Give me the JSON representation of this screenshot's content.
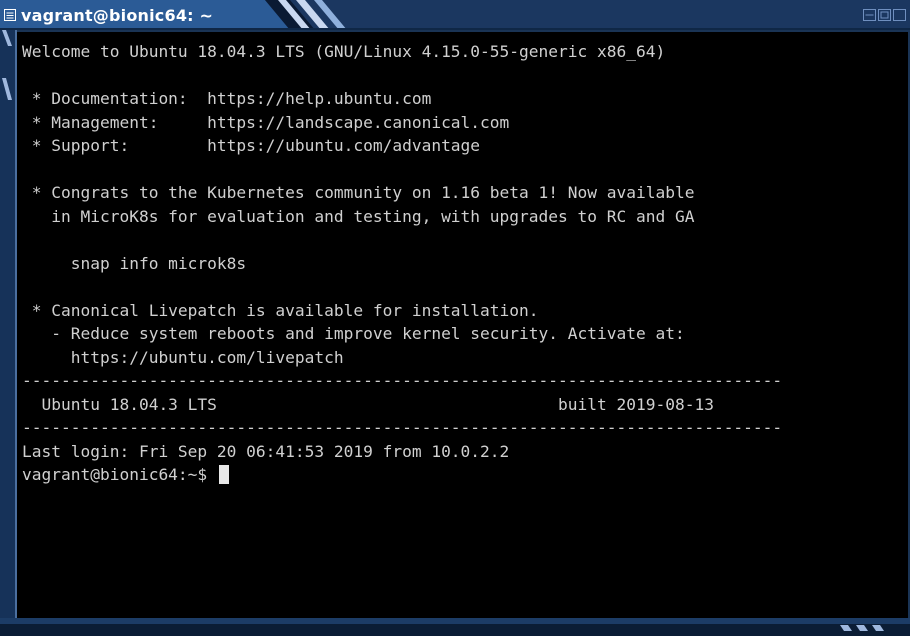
{
  "window": {
    "title": "vagrant@bionic64: ~"
  },
  "terminal": {
    "lines": [
      "Welcome to Ubuntu 18.04.3 LTS (GNU/Linux 4.15.0-55-generic x86_64)",
      "",
      " * Documentation:  https://help.ubuntu.com",
      " * Management:     https://landscape.canonical.com",
      " * Support:        https://ubuntu.com/advantage",
      "",
      " * Congrats to the Kubernetes community on 1.16 beta 1! Now available",
      "   in MicroK8s for evaluation and testing, with upgrades to RC and GA",
      "",
      "     snap info microk8s",
      "",
      " * Canonical Livepatch is available for installation.",
      "   - Reduce system reboots and improve kernel security. Activate at:",
      "     https://ubuntu.com/livepatch",
      "------------------------------------------------------------------------------",
      "  Ubuntu 18.04.3 LTS                                   built 2019-08-13",
      "------------------------------------------------------------------------------",
      "Last login: Fri Sep 20 06:41:53 2019 from 10.0.2.2"
    ],
    "prompt": "vagrant@bionic64:~$ "
  },
  "colors": {
    "titlebar": "#1b3760",
    "terminal_bg": "#000000",
    "terminal_fg": "#d0d0d0"
  }
}
